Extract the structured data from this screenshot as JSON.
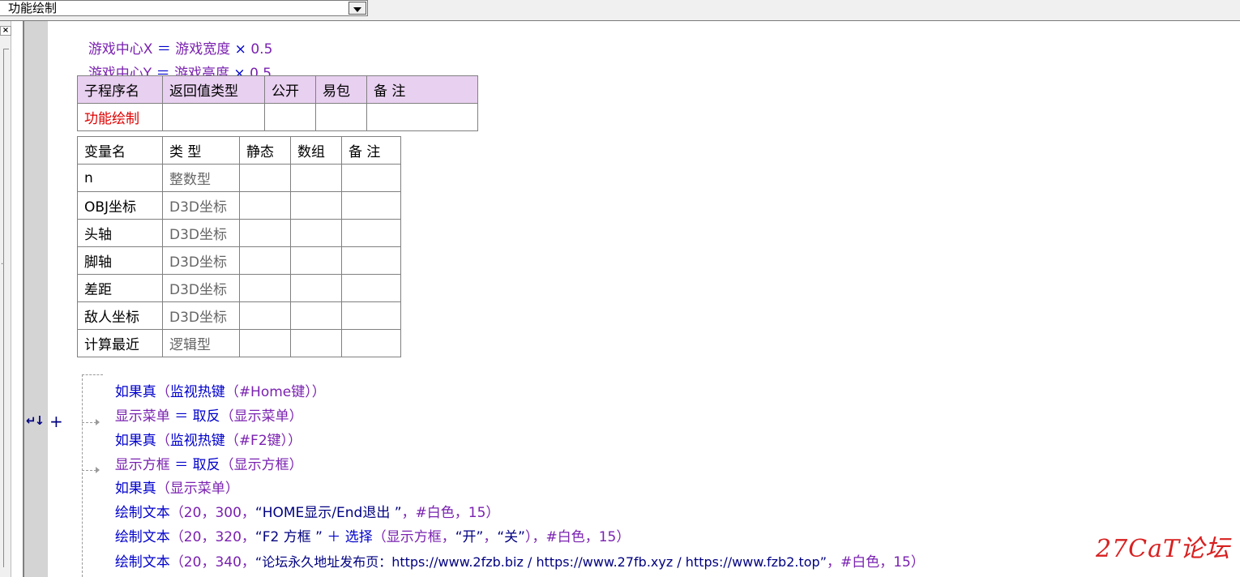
{
  "combo": {
    "selected": "功能绘制"
  },
  "left_panel": {
    "close_label": "×"
  },
  "gutter": {
    "fold_marker": "↵↓",
    "fold_plus": "+"
  },
  "code_top": [
    {
      "lhs": "游戏中心X",
      "op": " ＝ ",
      "a": "游戏宽度",
      "mul": " × ",
      "n": "0.5"
    },
    {
      "lhs": "游戏中心Y",
      "op": " ＝ ",
      "a": "游戏高度",
      "mul": " × ",
      "n": "0.5"
    }
  ],
  "sub_table": {
    "headers": [
      "子程序名",
      "返回值类型",
      "公开",
      "易包",
      "备 注"
    ],
    "row": [
      "功能绘制",
      "",
      "",
      "",
      ""
    ]
  },
  "var_table": {
    "headers": [
      "变量名",
      "类 型",
      "静态",
      "数组",
      "备 注"
    ],
    "rows": [
      [
        "n",
        "整数型"
      ],
      [
        "OBJ坐标",
        "D3D坐标"
      ],
      [
        "头轴",
        "D3D坐标"
      ],
      [
        "脚轴",
        "D3D坐标"
      ],
      [
        "差距",
        "D3D坐标"
      ],
      [
        "敌人坐标",
        "D3D坐标"
      ],
      [
        "计算最近",
        "逻辑型"
      ]
    ]
  },
  "code_lines": {
    "l1": {
      "kw": "如果真",
      "p1": "（",
      "fn": "监视热键",
      "p2": "（",
      "arg": "#Home键",
      "p3": "））"
    },
    "l2": {
      "v": "显示菜单",
      "op": " ＝ ",
      "fn": "取反",
      "p1": "（",
      "arg": "显示菜单",
      "p2": "）"
    },
    "l3": {
      "kw": "如果真",
      "p1": "（",
      "fn": "监视热键",
      "p2": "（",
      "arg": "#F2键",
      "p3": "））"
    },
    "l4": {
      "v": "显示方框",
      "op": " ＝ ",
      "fn": "取反",
      "p1": "（",
      "arg": "显示方框",
      "p2": "）"
    },
    "l5": {
      "kw": "如果真",
      "p1": "（",
      "arg": "显示菜单",
      "p2": "）"
    },
    "l6": {
      "fn": "绘制文本",
      "args": "（20，300，",
      "str": "“HOME显示/End退出 ”",
      "rest": "，#白色，15）"
    },
    "l7": {
      "fn": "绘制文本",
      "args": "（20，320，",
      "str": "“F2 方框 ”",
      "plus": " ＋ ",
      "sel": "选择",
      "p1": "（",
      "a1": "显示方框，",
      "s1": "“开”",
      "c": "，",
      "s2": "“关”",
      "rest": "），#白色，15）"
    },
    "l8": {
      "fn": "绘制文本",
      "args": "（20，340，",
      "str": "“论坛永久地址发布页：https://www.2fzb.biz / https://www.27fb.xyz / https://www.fzb2.top”",
      "rest": "，#白色，15）"
    }
  },
  "watermark": "27CaT论坛"
}
